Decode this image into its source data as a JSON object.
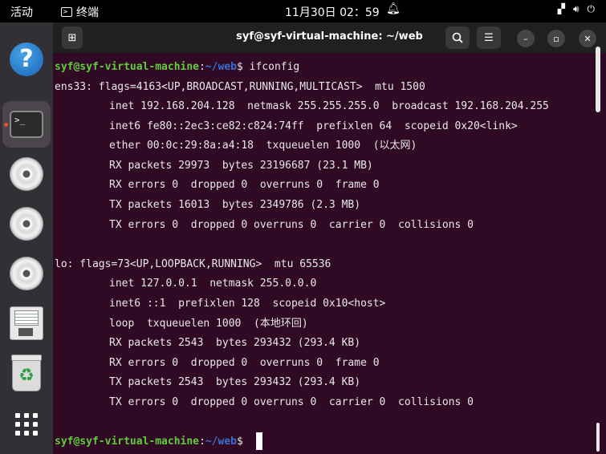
{
  "topbar": {
    "activities": "活动",
    "app_name": "终端",
    "clock": "11月30日  02：59"
  },
  "window": {
    "title": "syf@syf-virtual-machine: ~/web"
  },
  "terminal": {
    "prompt_user": "syf@syf-virtual-machine",
    "prompt_sep": ":",
    "prompt_path": "~/web",
    "prompt_dollar": "$ ",
    "command": "ifconfig",
    "lines": [
      "ens33: flags=4163<UP,BROADCAST,RUNNING,MULTICAST>  mtu 1500",
      "inet 192.168.204.128  netmask 255.255.255.0  broadcast 192.168.204.255",
      "inet6 fe80::2ec3:ce82:c824:74ff  prefixlen 64  scopeid 0x20<link>",
      "ether 00:0c:29:8a:a4:18  txqueuelen 1000  (以太网)",
      "RX packets 29973  bytes 23196687 (23.1 MB)",
      "RX errors 0  dropped 0  overruns 0  frame 0",
      "TX packets 16013  bytes 2349786 (2.3 MB)",
      "TX errors 0  dropped 0 overruns 0  carrier 0  collisions 0",
      "",
      "lo: flags=73<UP,LOOPBACK,RUNNING>  mtu 65536",
      "inet 127.0.0.1  netmask 255.0.0.0",
      "inet6 ::1  prefixlen 128  scopeid 0x10<host>",
      "loop  txqueuelen 1000  (本地环回)",
      "RX packets 2543  bytes 293432 (293.4 KB)",
      "RX errors 0  dropped 0  overruns 0  frame 0",
      "TX packets 2543  bytes 293432 (293.4 KB)",
      "TX errors 0  dropped 0 overruns 0  carrier 0  collisions 0"
    ]
  },
  "icons": {
    "dock": [
      "help-icon",
      "terminal-icon",
      "disc-icon",
      "disc-icon",
      "disc-icon",
      "floppy-icon",
      "trash-icon",
      "show-apps-icon"
    ],
    "topbar": [
      "bell-icon",
      "network-icon",
      "volume-icon",
      "power-icon"
    ],
    "titlebar": [
      "new-tab-icon",
      "search-icon",
      "menu-icon",
      "minimize-icon",
      "maximize-icon",
      "close-icon"
    ]
  },
  "colors": {
    "terminal_bg": "#300a24",
    "prompt_user": "#5fcd3a",
    "prompt_path": "#3a6fd0",
    "accent": "#e95420"
  }
}
